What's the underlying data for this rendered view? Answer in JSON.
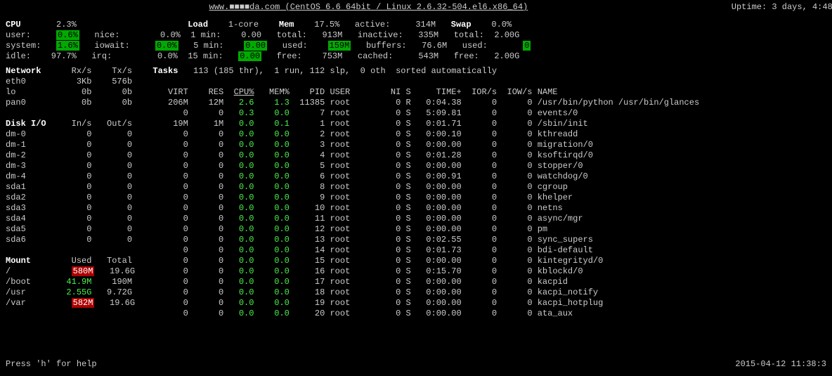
{
  "hdr": {
    "host": "www.■■■■da.com",
    "osinfo": "(CentOS 6.6 64bit / Linux 2.6.32-504.el6.x86_64)",
    "uptime": "Uptime: 3 days, 4:48:"
  },
  "cpu": {
    "label": "CPU",
    "total": "2.3%",
    "user_l": "user:",
    "user": "0.6%",
    "nice_l": "nice:",
    "nice": "0.0%",
    "system_l": "system:",
    "system": "1.6%",
    "iowait_l": "iowait:",
    "iowait": "0.0%",
    "idle_l": "idle:",
    "idle": "97.7%",
    "irq_l": "irq:",
    "irq": "0.0%"
  },
  "load": {
    "label": "Load",
    "core": "1-core",
    "l1": "1 min:",
    "v1": "0.00",
    "l5": "5 min:",
    "v5": "0.00",
    "l15": "15 min:",
    "v15": "0.00"
  },
  "mem": {
    "label": "Mem",
    "pct": "17.5%",
    "total_l": "total:",
    "total": "913M",
    "used_l": "used:",
    "used": "159M",
    "free_l": "free:",
    "free": "753M",
    "active_l": "active:",
    "active": "314M",
    "inactive_l": "inactive:",
    "inactive": "335M",
    "buffers_l": "buffers:",
    "buffers": "76.6M",
    "cached_l": "cached:",
    "cached": "543M"
  },
  "swap": {
    "label": "Swap",
    "pct": "0.0%",
    "total_l": "total:",
    "total": "2.00G",
    "used_l": "used:",
    "used": "0",
    "free_l": "free:",
    "free": "2.00G"
  },
  "net": {
    "label": "Network",
    "h1": "Rx/s",
    "h2": "Tx/s",
    "rows": [
      [
        "eth0",
        "3Kb",
        "576b"
      ],
      [
        "lo",
        "0b",
        "0b"
      ],
      [
        "pan0",
        "0b",
        "0b"
      ]
    ]
  },
  "disk": {
    "label": "Disk I/O",
    "h1": "In/s",
    "h2": "Out/s",
    "rows": [
      [
        "dm-0",
        "0",
        "0"
      ],
      [
        "dm-1",
        "0",
        "0"
      ],
      [
        "dm-2",
        "0",
        "0"
      ],
      [
        "dm-3",
        "0",
        "0"
      ],
      [
        "dm-4",
        "0",
        "0"
      ],
      [
        "sda1",
        "0",
        "0"
      ],
      [
        "sda2",
        "0",
        "0"
      ],
      [
        "sda3",
        "0",
        "0"
      ],
      [
        "sda4",
        "0",
        "0"
      ],
      [
        "sda5",
        "0",
        "0"
      ],
      [
        "sda6",
        "0",
        "0"
      ]
    ]
  },
  "mount": {
    "label": "Mount",
    "h1": "Used",
    "h2": "Total",
    "rows": [
      [
        "/",
        "580M",
        "19.6G",
        "r"
      ],
      [
        "/boot",
        "41.9M",
        "190M",
        "g"
      ],
      [
        "/usr",
        "2.55G",
        "9.72G",
        "g"
      ],
      [
        "/var",
        "582M",
        "19.6G",
        "r"
      ]
    ]
  },
  "tasks": {
    "label": "Tasks",
    "summary": "113 (185 thr),  1 run, 112 slp,  0 oth  sorted automatically"
  },
  "colhdr": {
    "virt": "VIRT",
    "res": "RES",
    "cpu": "CPU%",
    "mem": "MEM%",
    "pid": "PID",
    "user": "USER",
    "ni": "NI",
    "s": "S",
    "time": "TIME+",
    "ior": "IOR/s",
    "iow": "IOW/s",
    "name": "NAME"
  },
  "procs": [
    {
      "virt": "206M",
      "res": "12M",
      "cpu": "2.6",
      "mem": "1.3",
      "pid": "11385",
      "user": "root",
      "ni": "0",
      "s": "R",
      "time": "0:04.38",
      "ior": "0",
      "iow": "0",
      "name": "/usr/bin/python /usr/bin/glances"
    },
    {
      "virt": "0",
      "res": "0",
      "cpu": "0.3",
      "mem": "0.0",
      "pid": "7",
      "user": "root",
      "ni": "0",
      "s": "S",
      "time": "5:09.81",
      "ior": "0",
      "iow": "0",
      "name": "events/0"
    },
    {
      "virt": "19M",
      "res": "1M",
      "cpu": "0.0",
      "mem": "0.1",
      "pid": "1",
      "user": "root",
      "ni": "0",
      "s": "S",
      "time": "0:01.71",
      "ior": "0",
      "iow": "0",
      "name": "/sbin/init"
    },
    {
      "virt": "0",
      "res": "0",
      "cpu": "0.0",
      "mem": "0.0",
      "pid": "2",
      "user": "root",
      "ni": "0",
      "s": "S",
      "time": "0:00.10",
      "ior": "0",
      "iow": "0",
      "name": "kthreadd"
    },
    {
      "virt": "0",
      "res": "0",
      "cpu": "0.0",
      "mem": "0.0",
      "pid": "3",
      "user": "root",
      "ni": "0",
      "s": "S",
      "time": "0:00.00",
      "ior": "0",
      "iow": "0",
      "name": "migration/0"
    },
    {
      "virt": "0",
      "res": "0",
      "cpu": "0.0",
      "mem": "0.0",
      "pid": "4",
      "user": "root",
      "ni": "0",
      "s": "S",
      "time": "0:01.28",
      "ior": "0",
      "iow": "0",
      "name": "ksoftirqd/0"
    },
    {
      "virt": "0",
      "res": "0",
      "cpu": "0.0",
      "mem": "0.0",
      "pid": "5",
      "user": "root",
      "ni": "0",
      "s": "S",
      "time": "0:00.00",
      "ior": "0",
      "iow": "0",
      "name": "stopper/0"
    },
    {
      "virt": "0",
      "res": "0",
      "cpu": "0.0",
      "mem": "0.0",
      "pid": "6",
      "user": "root",
      "ni": "0",
      "s": "S",
      "time": "0:00.91",
      "ior": "0",
      "iow": "0",
      "name": "watchdog/0"
    },
    {
      "virt": "0",
      "res": "0",
      "cpu": "0.0",
      "mem": "0.0",
      "pid": "8",
      "user": "root",
      "ni": "0",
      "s": "S",
      "time": "0:00.00",
      "ior": "0",
      "iow": "0",
      "name": "cgroup"
    },
    {
      "virt": "0",
      "res": "0",
      "cpu": "0.0",
      "mem": "0.0",
      "pid": "9",
      "user": "root",
      "ni": "0",
      "s": "S",
      "time": "0:00.00",
      "ior": "0",
      "iow": "0",
      "name": "khelper"
    },
    {
      "virt": "0",
      "res": "0",
      "cpu": "0.0",
      "mem": "0.0",
      "pid": "10",
      "user": "root",
      "ni": "0",
      "s": "S",
      "time": "0:00.00",
      "ior": "0",
      "iow": "0",
      "name": "netns"
    },
    {
      "virt": "0",
      "res": "0",
      "cpu": "0.0",
      "mem": "0.0",
      "pid": "11",
      "user": "root",
      "ni": "0",
      "s": "S",
      "time": "0:00.00",
      "ior": "0",
      "iow": "0",
      "name": "async/mgr"
    },
    {
      "virt": "0",
      "res": "0",
      "cpu": "0.0",
      "mem": "0.0",
      "pid": "12",
      "user": "root",
      "ni": "0",
      "s": "S",
      "time": "0:00.00",
      "ior": "0",
      "iow": "0",
      "name": "pm"
    },
    {
      "virt": "0",
      "res": "0",
      "cpu": "0.0",
      "mem": "0.0",
      "pid": "13",
      "user": "root",
      "ni": "0",
      "s": "S",
      "time": "0:02.55",
      "ior": "0",
      "iow": "0",
      "name": "sync_supers"
    },
    {
      "virt": "0",
      "res": "0",
      "cpu": "0.0",
      "mem": "0.0",
      "pid": "14",
      "user": "root",
      "ni": "0",
      "s": "S",
      "time": "0:01.73",
      "ior": "0",
      "iow": "0",
      "name": "bdi-default"
    },
    {
      "virt": "0",
      "res": "0",
      "cpu": "0.0",
      "mem": "0.0",
      "pid": "15",
      "user": "root",
      "ni": "0",
      "s": "S",
      "time": "0:00.00",
      "ior": "0",
      "iow": "0",
      "name": "kintegrityd/0"
    },
    {
      "virt": "0",
      "res": "0",
      "cpu": "0.0",
      "mem": "0.0",
      "pid": "16",
      "user": "root",
      "ni": "0",
      "s": "S",
      "time": "0:15.70",
      "ior": "0",
      "iow": "0",
      "name": "kblockd/0"
    },
    {
      "virt": "0",
      "res": "0",
      "cpu": "0.0",
      "mem": "0.0",
      "pid": "17",
      "user": "root",
      "ni": "0",
      "s": "S",
      "time": "0:00.00",
      "ior": "0",
      "iow": "0",
      "name": "kacpid"
    },
    {
      "virt": "0",
      "res": "0",
      "cpu": "0.0",
      "mem": "0.0",
      "pid": "18",
      "user": "root",
      "ni": "0",
      "s": "S",
      "time": "0:00.00",
      "ior": "0",
      "iow": "0",
      "name": "kacpi_notify"
    },
    {
      "virt": "0",
      "res": "0",
      "cpu": "0.0",
      "mem": "0.0",
      "pid": "19",
      "user": "root",
      "ni": "0",
      "s": "S",
      "time": "0:00.00",
      "ior": "0",
      "iow": "0",
      "name": "kacpi_hotplug"
    },
    {
      "virt": "0",
      "res": "0",
      "cpu": "0.0",
      "mem": "0.0",
      "pid": "20",
      "user": "root",
      "ni": "0",
      "s": "S",
      "time": "0:00.00",
      "ior": "0",
      "iow": "0",
      "name": "ata_aux"
    }
  ],
  "foot": {
    "help": "Press 'h' for help",
    "ts": "2015-04-12 11:38:3"
  }
}
